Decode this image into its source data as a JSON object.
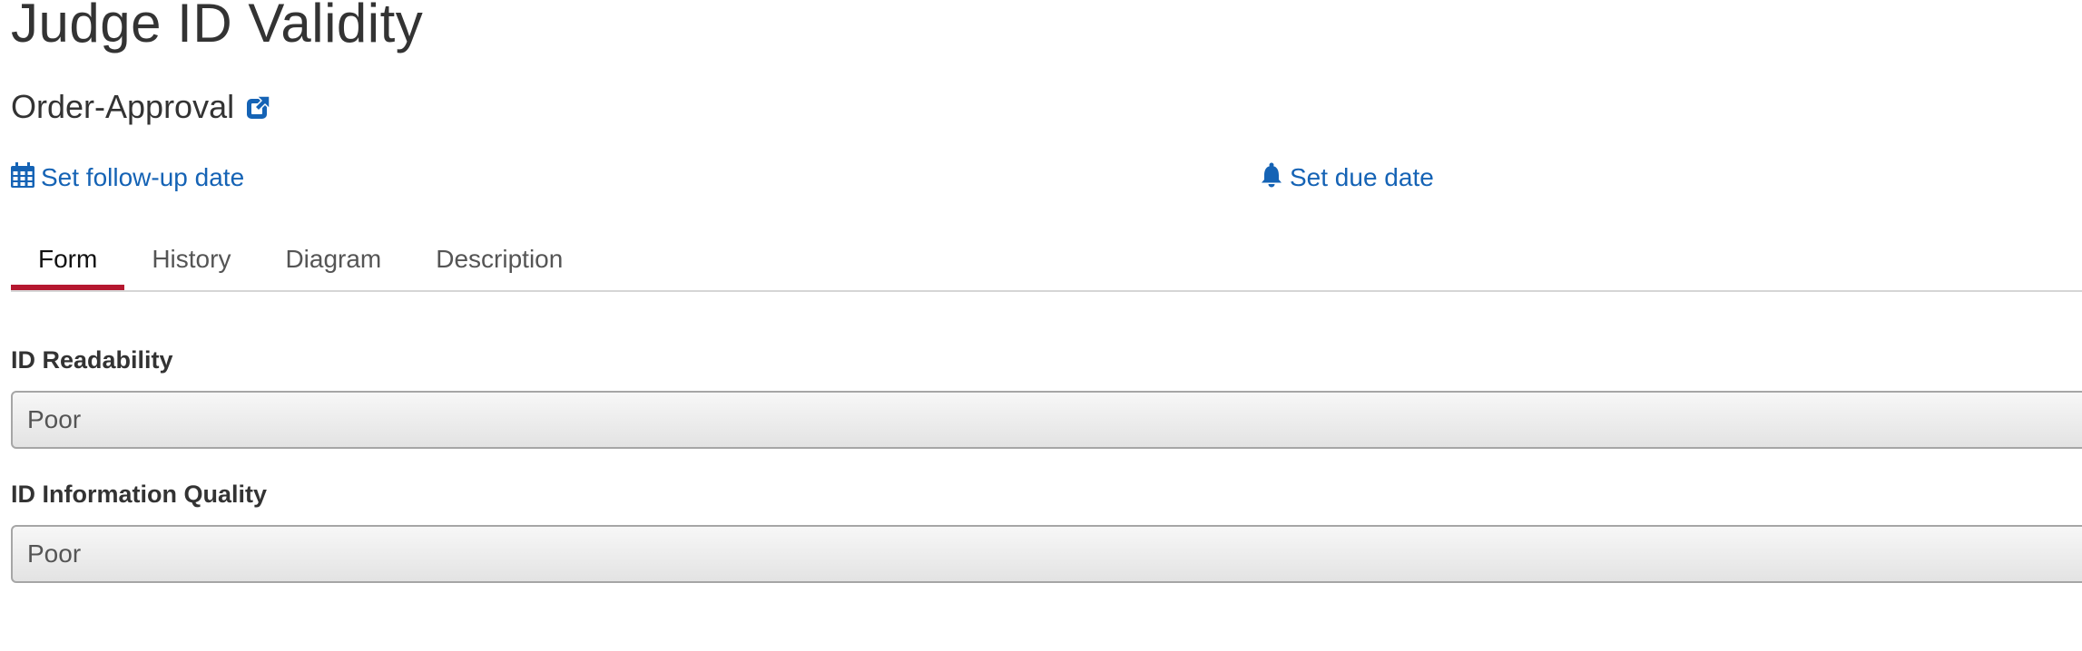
{
  "task": {
    "title": "Judge ID Validity",
    "process_name": "Order-Approval"
  },
  "actions": {
    "followup_label": "Set follow-up date",
    "due_label": "Set due date"
  },
  "tabs": [
    {
      "label": "Form",
      "active": true
    },
    {
      "label": "History",
      "active": false
    },
    {
      "label": "Diagram",
      "active": false
    },
    {
      "label": "Description",
      "active": false
    }
  ],
  "form": {
    "fields": [
      {
        "label": "ID Readability",
        "value": "Poor"
      },
      {
        "label": "ID Information Quality",
        "value": "Poor"
      }
    ]
  },
  "colors": {
    "link": "#1563b5",
    "active_tab_indicator": "#b5172f",
    "text": "#333333"
  },
  "icons": {
    "process_link": "external-link-icon",
    "followup": "calendar-icon",
    "due": "bell-icon"
  }
}
